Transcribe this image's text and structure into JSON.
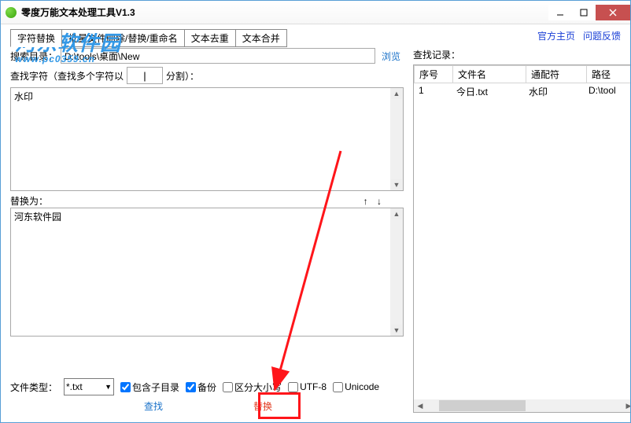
{
  "titlebar": {
    "title": "零度万能文本处理工具V1.3"
  },
  "watermark": {
    "main": "河东软件园",
    "sub": "www.pc0359.cn"
  },
  "tabs": {
    "t1": "字符替换",
    "t2": "批量文件删除/替换/重命名",
    "t3": "文本去重",
    "t4": "文本合并"
  },
  "toplinks": {
    "home": "官方主页",
    "feedback": "问题反馈"
  },
  "left": {
    "search_dir_label": "搜索目录：",
    "search_dir_value": "D:\\tools\\桌面\\New",
    "browse": "浏览",
    "find_chars_pre": "查找字符（查找多个字符以",
    "sep_value": "|",
    "find_chars_post": "分割）：",
    "find_text": "水印",
    "replace_label": "替换为：",
    "arrows": "↑ ↓",
    "replace_text": "河东软件园",
    "file_type_label": "文件类型：",
    "file_type_value": "*.txt",
    "cb_subdir": "包含子目录",
    "cb_backup": "备份",
    "cb_case": "区分大小写",
    "cb_utf8": "UTF-8",
    "cb_unicode": "Unicode",
    "act_find": "查找",
    "act_replace": "替换"
  },
  "right": {
    "title": "查找记录：",
    "headers": {
      "sn": "序号",
      "file": "文件名",
      "wc": "通配符",
      "path": "路径"
    },
    "rows": [
      {
        "sn": "1",
        "file": "今日.txt",
        "wc": "水印",
        "path": "D:\\tool"
      }
    ]
  }
}
